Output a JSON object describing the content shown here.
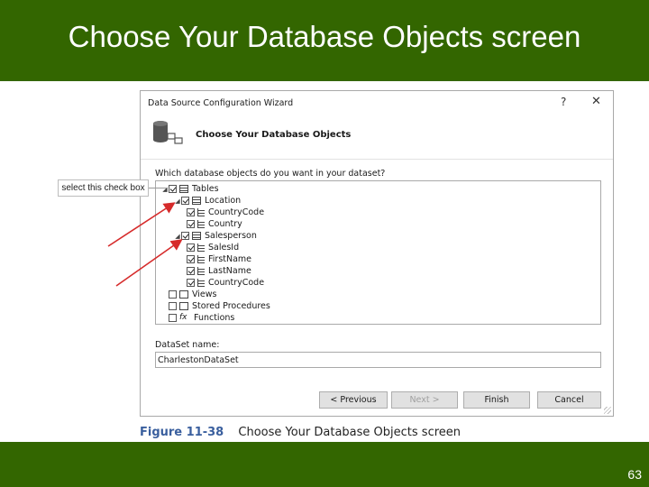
{
  "slide": {
    "title": "Choose Your Database Objects screen",
    "page_number": "63",
    "colors": {
      "band": "#336600",
      "arrow": "#d62b2b"
    }
  },
  "dialog": {
    "title": "Data Source Configuration Wizard",
    "help": "?",
    "close": "✕",
    "heading": "Choose Your Database Objects",
    "question": "Which database objects do you want in your dataset?",
    "tree": [
      {
        "label": "Tables",
        "checked": true,
        "icon": "table-icon"
      },
      {
        "label": "Location",
        "checked": true,
        "icon": "table-icon"
      },
      {
        "label": "CountryCode",
        "checked": true,
        "icon": "field-icon"
      },
      {
        "label": "Country",
        "checked": true,
        "icon": "field-icon"
      },
      {
        "label": "Salesperson",
        "checked": true,
        "icon": "table-icon"
      },
      {
        "label": "SalesId",
        "checked": true,
        "icon": "field-icon"
      },
      {
        "label": "FirstName",
        "checked": true,
        "icon": "field-icon"
      },
      {
        "label": "LastName",
        "checked": true,
        "icon": "field-icon"
      },
      {
        "label": "CountryCode",
        "checked": true,
        "icon": "field-icon"
      },
      {
        "label": "Views",
        "checked": false,
        "icon": "view-icon"
      },
      {
        "label": "Stored Procedures",
        "checked": false,
        "icon": "procedure-icon"
      },
      {
        "label": "Functions",
        "checked": false,
        "icon": "function-icon"
      }
    ],
    "dataset_label": "DataSet name:",
    "dataset_value": "CharlestonDataSet",
    "buttons": {
      "previous": "< Previous",
      "next": "Next >",
      "finish": "Finish",
      "cancel": "Cancel"
    }
  },
  "callout": {
    "text": "select this check box"
  },
  "caption": {
    "figure": "Figure 11-38",
    "text": "Choose Your Database Objects screen"
  }
}
